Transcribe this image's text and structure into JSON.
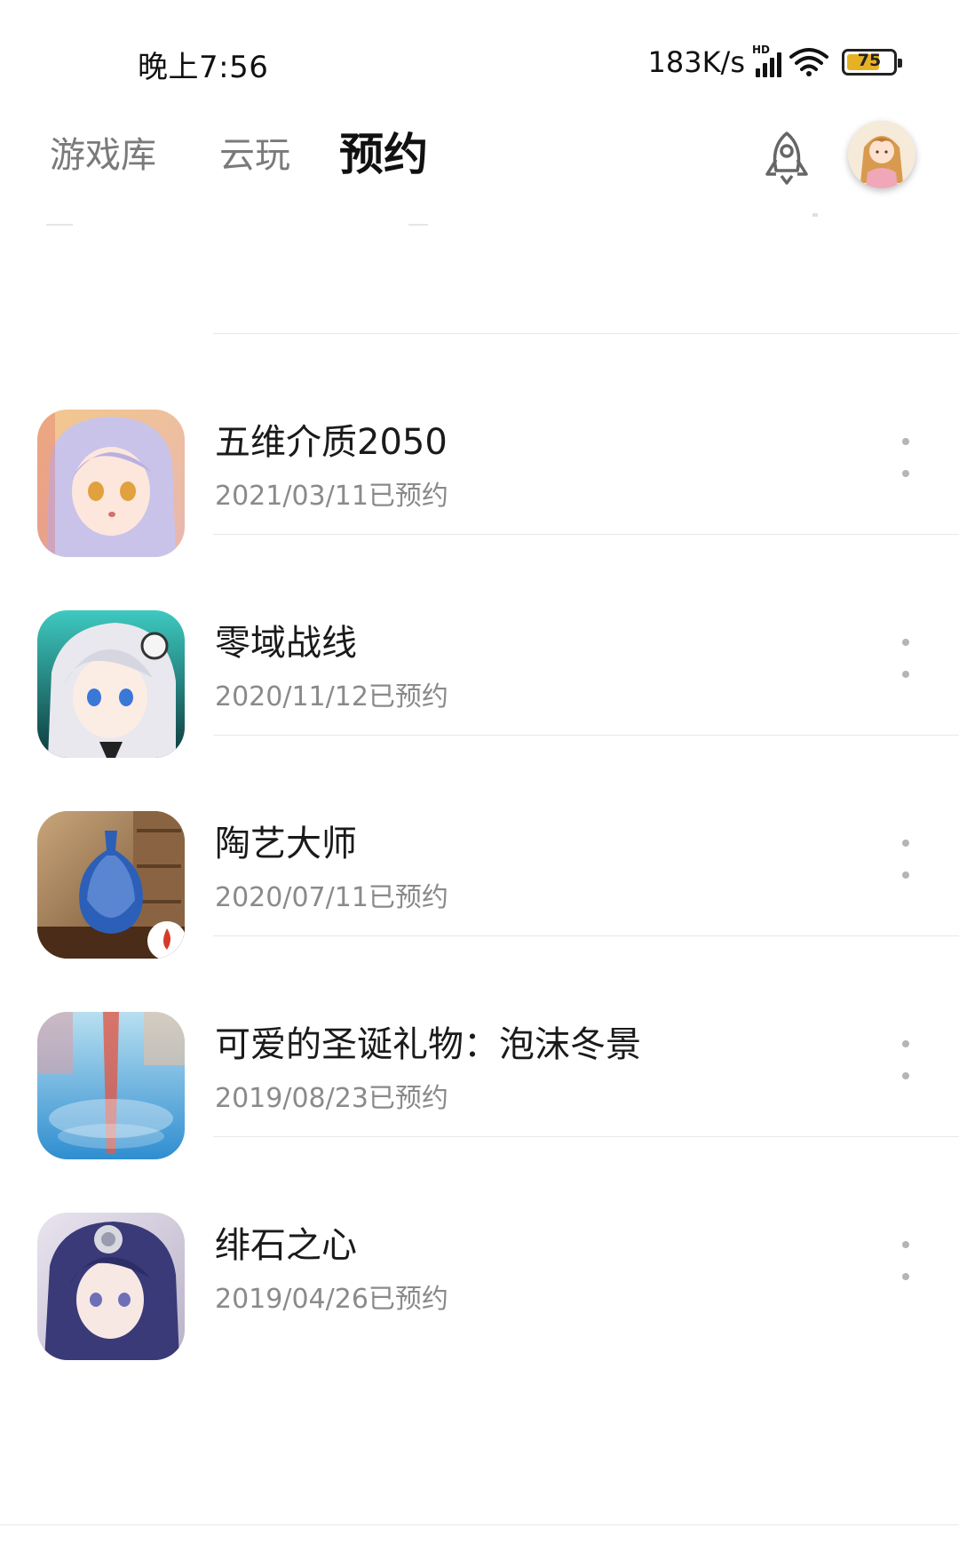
{
  "status_bar": {
    "time": "晚上7:56",
    "net_speed": "183K/s",
    "network_type": "HD",
    "battery_level": "75",
    "battery_color": "#e7b124"
  },
  "tabs": [
    {
      "label": "游戏库",
      "active": false
    },
    {
      "label": "云玩",
      "active": false
    },
    {
      "label": "预约",
      "active": true
    }
  ],
  "header_icons": {
    "launch": "rocket-icon",
    "profile": "avatar"
  },
  "reservations": [
    {
      "title": "五维介质2050",
      "date": "2021/03/11已预约"
    },
    {
      "title": "零域战线",
      "date": "2020/11/12已预约"
    },
    {
      "title": "陶艺大师",
      "date": "2020/07/11已预约"
    },
    {
      "title": "可爱的圣诞礼物：泡沫冬景",
      "date": "2019/08/23已预约"
    },
    {
      "title": "绯石之心",
      "date": "2019/04/26已预约"
    }
  ],
  "colors": {
    "active_tab": "#111111",
    "inactive_tab": "#7a7a7a",
    "date_text": "#8a8a8a",
    "divider": "#e8e8e8"
  }
}
